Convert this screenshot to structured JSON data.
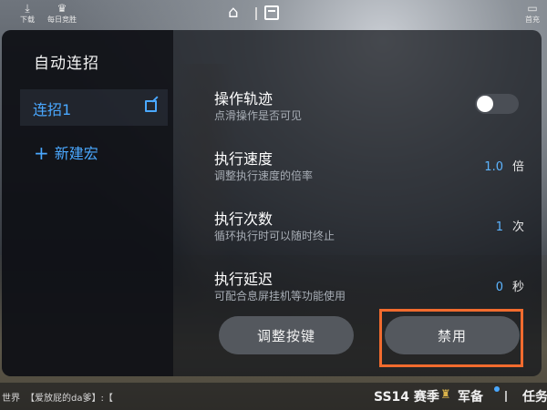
{
  "topbar": {
    "download_label": "下载",
    "daily_label": "每日竞胜",
    "recharge_label": "首充"
  },
  "panel": {
    "title": "自动连招",
    "macros": [
      {
        "label": "连招1",
        "selected": true
      }
    ],
    "new_macro_label": "新建宏",
    "settings": [
      {
        "name": "操作轨迹",
        "desc": "点滑操作是否可见",
        "control": "toggle",
        "on": false
      },
      {
        "name": "执行速度",
        "desc": "调整执行速度的倍率",
        "value": "1.0",
        "unit": "倍"
      },
      {
        "name": "执行次数",
        "desc": "循环执行时可以随时终止",
        "value": "1",
        "unit": "次"
      },
      {
        "name": "执行延迟",
        "desc": "可配合息屏挂机等功能使用",
        "value": "0",
        "unit": "秒"
      }
    ],
    "adjust_button": "调整按键",
    "disable_button": "禁用"
  },
  "bottombar": {
    "chat_channel": "世界",
    "chat_text": "【爱放屁的da爹】:【",
    "season": "SS14 赛季",
    "armory": "军备",
    "tasks": "任务"
  },
  "colors": {
    "accent": "#4aa8ff",
    "highlight": "#f26b2e"
  }
}
